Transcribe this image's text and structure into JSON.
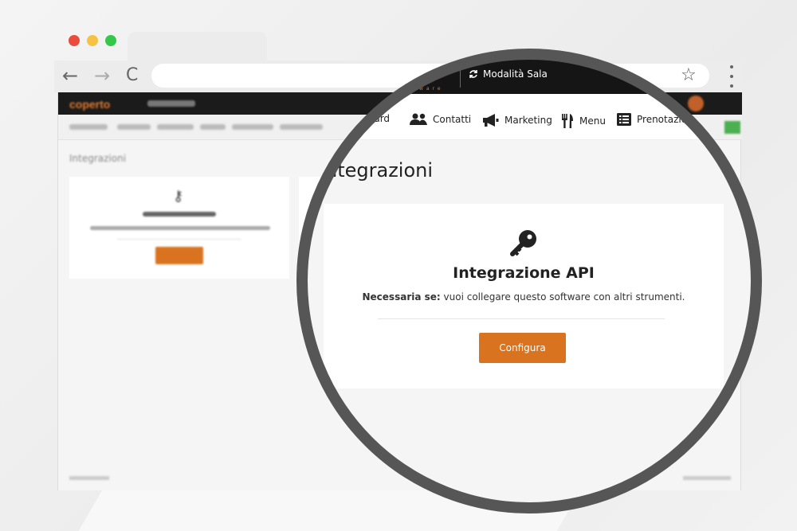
{
  "colors": {
    "accent": "#d9731f",
    "brand_dark": "#151515",
    "ring": "#565656",
    "traffic": [
      "#e94b3c",
      "#f5c242",
      "#34c84a"
    ]
  },
  "browser": {
    "back_icon": "arrow-left-icon",
    "forward_icon": "arrow-right-icon",
    "reload_icon": "reload-icon",
    "bookmark_icon": "star-icon",
    "menu_icon": "kebab-icon",
    "back_glyph": "←",
    "forward_glyph": "→",
    "reload_glyph": "C",
    "star_glyph": "☆"
  },
  "topbar": {
    "brand": "co",
    "brand_sub": "ware",
    "mode_label": "Modalità Sala",
    "mode_icon": "sync-icon"
  },
  "nav": {
    "items": [
      {
        "label": "oard",
        "icon": "dashboard-icon"
      },
      {
        "label": "Contatti",
        "icon": "users-icon"
      },
      {
        "label": "Marketing",
        "icon": "megaphone-icon"
      },
      {
        "label": "Menu",
        "icon": "utensils-icon"
      },
      {
        "label": "Prenotazion",
        "icon": "list-icon"
      }
    ]
  },
  "page": {
    "title": "ntegrazioni",
    "background_title": "Integrazioni"
  },
  "card": {
    "icon": "key-icon",
    "title": "Integrazione API",
    "desc_bold": "Necessaria se:",
    "desc_rest": " vuoi collegare questo software con altri strumenti.",
    "button_label": "Configura"
  }
}
